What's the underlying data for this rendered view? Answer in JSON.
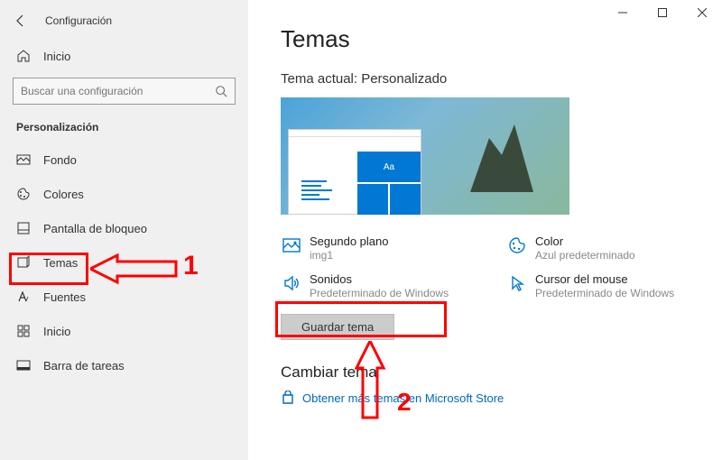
{
  "app": {
    "title": "Configuración"
  },
  "home": {
    "label": "Inicio"
  },
  "search": {
    "placeholder": "Buscar una configuración"
  },
  "section": {
    "title": "Personalización"
  },
  "nav": [
    {
      "label": "Fondo",
      "icon": "image-icon"
    },
    {
      "label": "Colores",
      "icon": "palette-icon"
    },
    {
      "label": "Pantalla de bloqueo",
      "icon": "lockscreen-icon"
    },
    {
      "label": "Temas",
      "icon": "theme-icon"
    },
    {
      "label": "Fuentes",
      "icon": "font-icon"
    },
    {
      "label": "Inicio",
      "icon": "start-icon"
    },
    {
      "label": "Barra de tareas",
      "icon": "taskbar-icon"
    }
  ],
  "page": {
    "title": "Temas",
    "current": "Tema actual: Personalizado",
    "preview_aa": "Aa",
    "items": [
      {
        "label": "Segundo plano",
        "value": "img1"
      },
      {
        "label": "Color",
        "value": "Azul predeterminado"
      },
      {
        "label": "Sonidos",
        "value": "Predeterminado de Windows"
      },
      {
        "label": "Cursor del mouse",
        "value": "Predeterminado de Windows"
      }
    ],
    "save": "Guardar tema",
    "change": "Cambiar tema",
    "store": "Obtener más temas en Microsoft Store"
  },
  "annotations": {
    "n1": "1",
    "n2": "2"
  }
}
